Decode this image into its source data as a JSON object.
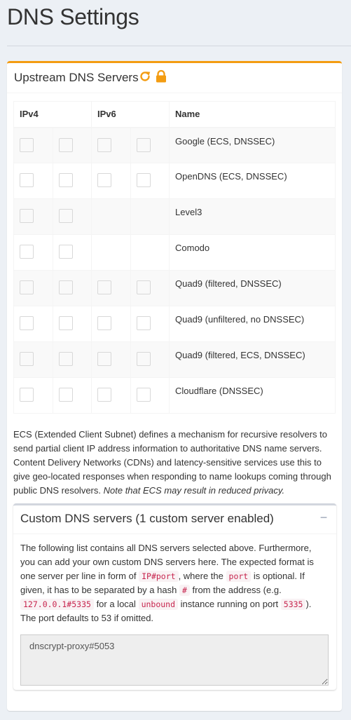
{
  "page": {
    "title": "DNS Settings"
  },
  "upstream": {
    "title": "Upstream DNS Servers",
    "columns": {
      "ipv4": "IPv4",
      "ipv6": "IPv6",
      "name": "Name"
    },
    "servers": [
      {
        "name": "Google (ECS, DNSSEC)",
        "ipv4_count": 2,
        "ipv6_count": 2
      },
      {
        "name": "OpenDNS (ECS, DNSSEC)",
        "ipv4_count": 2,
        "ipv6_count": 2
      },
      {
        "name": "Level3",
        "ipv4_count": 2,
        "ipv6_count": 0
      },
      {
        "name": "Comodo",
        "ipv4_count": 2,
        "ipv6_count": 0
      },
      {
        "name": "Quad9 (filtered, DNSSEC)",
        "ipv4_count": 2,
        "ipv6_count": 2
      },
      {
        "name": "Quad9 (unfiltered, no DNSSEC)",
        "ipv4_count": 2,
        "ipv6_count": 2
      },
      {
        "name": "Quad9 (filtered, ECS, DNSSEC)",
        "ipv4_count": 2,
        "ipv6_count": 2
      },
      {
        "name": "Cloudflare (DNSSEC)",
        "ipv4_count": 2,
        "ipv6_count": 2
      }
    ],
    "ecs_description": "ECS (Extended Client Subnet) defines a mechanism for recursive resolvers to send partial client IP address information to authoritative DNS name servers. Content Delivery Networks (CDNs) and latency-sensitive services use this to give geo-located responses when responding to name lookups coming through public DNS resolvers.",
    "ecs_note": "Note that ECS may result in reduced privacy."
  },
  "custom": {
    "title": "Custom DNS servers (1 custom server enabled)",
    "collapse_symbol": "−",
    "desc": {
      "p1": "The following list contains all DNS servers selected above. Furthermore, you can add your own custom DNS servers here. The expected format is one server per line in form of",
      "code1": "IP#port",
      "p2": ", where the",
      "code2": "port",
      "p3": "is optional. If given, it has to be separated by a hash",
      "code3": "#",
      "p4": "from the address (e.g.",
      "code4": "127.0.0.1#5335",
      "p5": "for a local",
      "code5": "unbound",
      "p6": "instance running on port",
      "code6": "5335",
      "p7": "). The port defaults to 53 if omitted."
    },
    "textarea_value": "dnscrypt-proxy#5053"
  },
  "colors": {
    "accent": "#f39c12",
    "background": "#ecf0f5",
    "code_text": "#c7254e",
    "code_bg": "#f9f2f4"
  },
  "icons": {
    "refresh": "refresh-icon",
    "lock": "lock-icon"
  }
}
